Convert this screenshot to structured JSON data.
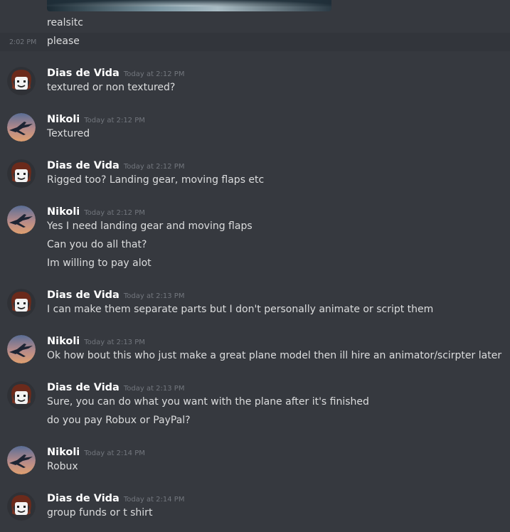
{
  "prev": {
    "author_line": "realsitc",
    "follow_time": "2:02 PM",
    "follow_text": "please"
  },
  "messages": [
    {
      "author": "Dias de Vida",
      "time": "Today at 2:12 PM",
      "avatar": "dias-avatar",
      "lines": [
        "textured or non textured?"
      ]
    },
    {
      "author": "Nikoli",
      "time": "Today at 2:12 PM",
      "avatar": "nikoli-avatar",
      "lines": [
        "Textured"
      ]
    },
    {
      "author": "Dias de Vida",
      "time": "Today at 2:12 PM",
      "avatar": "dias-avatar",
      "lines": [
        "Rigged too? Landing gear, moving flaps etc"
      ]
    },
    {
      "author": "Nikoli",
      "time": "Today at 2:12 PM",
      "avatar": "nikoli-avatar",
      "lines": [
        "Yes I need landing gear and moving flaps",
        "Can you do all that?",
        "Im willing to pay alot"
      ]
    },
    {
      "author": "Dias de Vida",
      "time": "Today at 2:13 PM",
      "avatar": "dias-avatar",
      "lines": [
        "I can make them separate parts but I don't personally animate or script them"
      ]
    },
    {
      "author": "Nikoli",
      "time": "Today at 2:13 PM",
      "avatar": "nikoli-avatar",
      "lines": [
        "Ok how bout this who just make a great plane model then ill hire an animator/scirpter later"
      ]
    },
    {
      "author": "Dias de Vida",
      "time": "Today at 2:13 PM",
      "avatar": "dias-avatar",
      "lines": [
        "Sure, you can do what you want with the plane after it's finished",
        "do you pay Robux or PayPal?"
      ]
    },
    {
      "author": "Nikoli",
      "time": "Today at 2:14 PM",
      "avatar": "nikoli-avatar",
      "lines": [
        "Robux"
      ]
    },
    {
      "author": "Dias de Vida",
      "time": "Today at 2:14 PM",
      "avatar": "dias-avatar",
      "lines": [
        "group funds or t shirt"
      ]
    }
  ]
}
